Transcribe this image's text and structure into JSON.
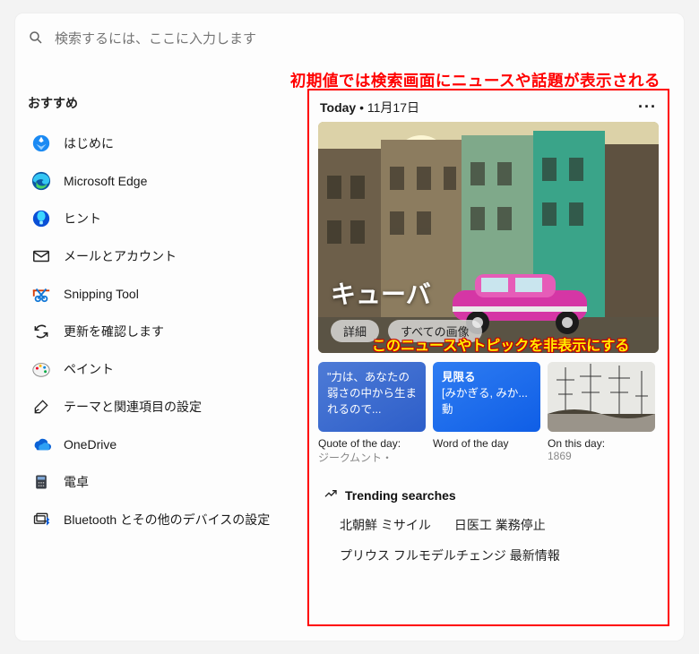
{
  "search": {
    "placeholder": "検索するには、ここに入力します"
  },
  "annotations": {
    "top": "初期値では検索画面にニュースや話題が表示される",
    "mid": "このニュースやトピックを非表示にする"
  },
  "sidebar": {
    "heading": "おすすめ",
    "items": [
      {
        "label": "はじめに",
        "icon": "getting-started-icon"
      },
      {
        "label": "Microsoft Edge",
        "icon": "edge-icon"
      },
      {
        "label": "ヒント",
        "icon": "tips-icon"
      },
      {
        "label": "メールとアカウント",
        "icon": "mail-icon"
      },
      {
        "label": "Snipping Tool",
        "icon": "snipping-icon"
      },
      {
        "label": "更新を確認します",
        "icon": "refresh-icon"
      },
      {
        "label": "ペイント",
        "icon": "paint-icon"
      },
      {
        "label": "テーマと関連項目の設定",
        "icon": "theme-icon"
      },
      {
        "label": "OneDrive",
        "icon": "onedrive-icon"
      },
      {
        "label": "電卓",
        "icon": "calculator-icon"
      },
      {
        "label": "Bluetooth とその他のデバイスの設定",
        "icon": "bluetooth-icon"
      }
    ]
  },
  "content": {
    "today_label": "Today",
    "date": "11月17日",
    "hero": {
      "title": "キューバ",
      "pills": [
        "詳細",
        "すべての画像"
      ]
    },
    "cards": [
      {
        "kind": "quote",
        "text": "\"力は、あなたの弱さの中から生まれるので...",
        "caption_title": "Quote of the day:",
        "caption_sub": "ジークムント・"
      },
      {
        "kind": "word",
        "title": "見限る",
        "sub": "[みかぎる, みか...",
        "pos": "動",
        "caption_title": "Word of the day",
        "caption_sub": ""
      },
      {
        "kind": "history",
        "caption_title": "On this day:",
        "caption_sub": "1869"
      }
    ],
    "trending": {
      "heading": "Trending searches",
      "items": [
        "北朝鮮 ミサイル",
        "日医工 業務停止",
        "プリウス フルモデルチェンジ 最新情報"
      ]
    }
  }
}
